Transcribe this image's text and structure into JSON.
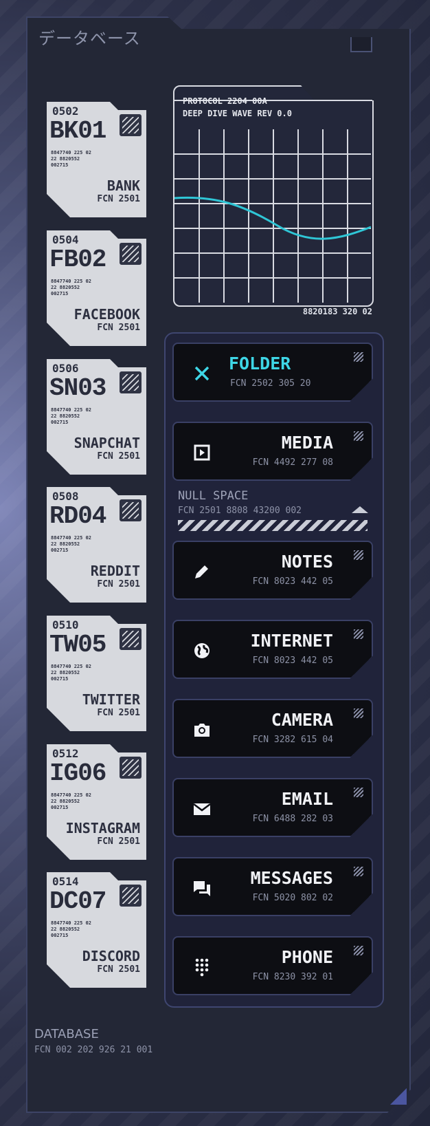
{
  "panel": {
    "title": "データベース",
    "footer_title": "DATABASE",
    "footer_code": "FCN 002 202 926 21 001"
  },
  "cards": [
    {
      "num": "0502",
      "code": "BK01",
      "fine": "8847740 225 02\n22 8820552\n002715",
      "name": "BANK",
      "fcn": "FCN 2501"
    },
    {
      "num": "0504",
      "code": "FB02",
      "fine": "8847740 225 02\n22 8820552\n002715",
      "name": "FACEBOOK",
      "fcn": "FCN 2501"
    },
    {
      "num": "0506",
      "code": "SN03",
      "fine": "8847740 225 02\n22 8820552\n002715",
      "name": "SNAPCHAT",
      "fcn": "FCN 2501"
    },
    {
      "num": "0508",
      "code": "RD04",
      "fine": "8847740 225 02\n22 8820552\n002715",
      "name": "REDDIT",
      "fcn": "FCN 2501"
    },
    {
      "num": "0510",
      "code": "TW05",
      "fine": "8847740 225 02\n22 8820552\n002715",
      "name": "TWITTER",
      "fcn": "FCN 2501"
    },
    {
      "num": "0512",
      "code": "IG06",
      "fine": "8847740 225 02\n22 8820552\n002715",
      "name": "INSTAGRAM",
      "fcn": "FCN 2501"
    },
    {
      "num": "0514",
      "code": "DC07",
      "fine": "8847740 225 02\n22 8820552\n002715",
      "name": "DISCORD",
      "fcn": "FCN 2501"
    }
  ],
  "chart": {
    "line1": "PROTOCOL 2204 00A",
    "line2": "DEEP DIVE WAVE REV 0.0",
    "footer": "8820183 320 02",
    "wave_color": "#2fc6d6"
  },
  "null_space": {
    "title": "NULL SPACE",
    "code": "FCN 2501 8808 43200 002"
  },
  "apps": {
    "folder": {
      "label": "FOLDER",
      "fcn": "FCN 2502 305 20",
      "icon": "close-icon"
    },
    "media": {
      "label": "MEDIA",
      "fcn": "FCN 4492 277 08",
      "icon": "play-icon"
    },
    "notes": {
      "label": "NOTES",
      "fcn": "FCN 8023 442 05",
      "icon": "pencil-icon"
    },
    "internet": {
      "label": "INTERNET",
      "fcn": "FCN 8023 442 05",
      "icon": "globe-icon"
    },
    "camera": {
      "label": "CAMERA",
      "fcn": "FCN 3282 615 04",
      "icon": "camera-icon"
    },
    "email": {
      "label": "EMAIL",
      "fcn": "FCN 6488 282 03",
      "icon": "mail-icon"
    },
    "messages": {
      "label": "MESSAGES",
      "fcn": "FCN 5020 802 02",
      "icon": "chat-icon"
    },
    "phone": {
      "label": "PHONE",
      "fcn": "FCN 8230 392 01",
      "icon": "dialpad-icon"
    }
  },
  "colors": {
    "accent": "#3ed6e6",
    "panel": "#232736",
    "card": "#d7d9de",
    "button": "#0d0e13",
    "corner": "#5560a8"
  }
}
